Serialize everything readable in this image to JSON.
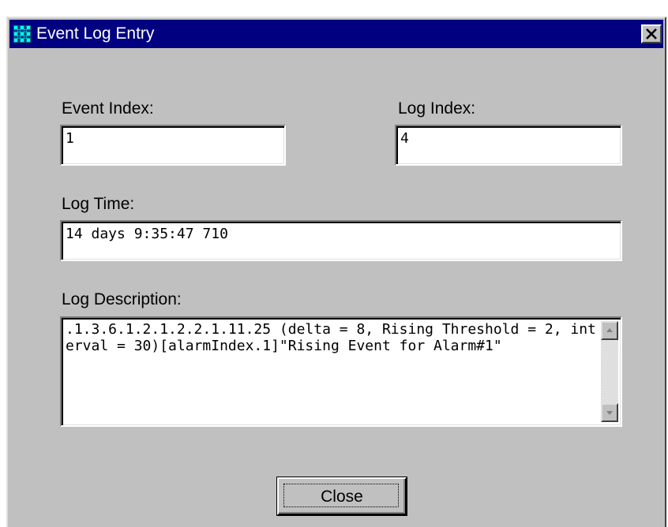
{
  "window": {
    "title": "Event Log Entry",
    "app_icon": "grid-app-icon",
    "close_icon": "close-icon"
  },
  "fields": {
    "event_index": {
      "label": "Event Index:",
      "value": "1"
    },
    "log_index": {
      "label": "Log Index:",
      "value": "4"
    },
    "log_time": {
      "label": "Log Time:",
      "value": "14 days 9:35:47 710"
    },
    "log_description": {
      "label": "Log Description:",
      "value": ".1.3.6.1.2.1.2.2.1.11.25 (delta = 8, Rising Threshold = 2, interval = 30)[alarmIndex.1]\"Rising Event for Alarm#1\""
    }
  },
  "buttons": {
    "close_label": "Close"
  },
  "colors": {
    "titlebar": "#000080",
    "face": "#c0c0c0"
  }
}
